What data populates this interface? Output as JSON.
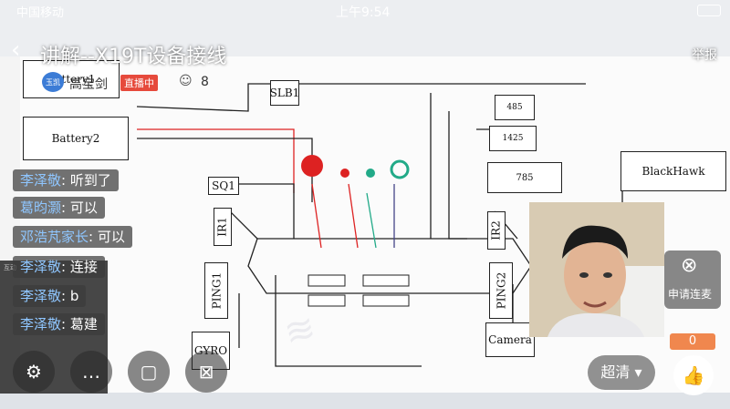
{
  "status_bar": {
    "carrier": "中国移动",
    "time": "上午9:54"
  },
  "stream": {
    "title": "讲解--X19T设备接线",
    "host_name": "高宝剑",
    "host_avatar_text": "玉凯",
    "live_badge": "直播中",
    "viewer_count": "8",
    "report": "举报",
    "comments": [
      {
        "user": "李泽敬",
        "text": "听到了"
      },
      {
        "user": "葛昀灏",
        "text": "可以"
      },
      {
        "user": "邓浩芃家长",
        "text": "可以"
      },
      {
        "user": "李泽敬",
        "text": "连接"
      },
      {
        "user": "李泽敬",
        "text": "b"
      },
      {
        "user": "李泽敬",
        "text": "葛建"
      }
    ],
    "mini_panel_title": "互动",
    "lianmai_label": "申请连麦",
    "gift_count": "0",
    "quality": "超清",
    "bottom_icons": [
      "settings-icon",
      "comment-icon",
      "gift-icon",
      "screen-share-icon"
    ]
  },
  "diagram": {
    "battery1": "Battery1",
    "battery2": "Battery2",
    "slb1": "SLB1",
    "sq1": "SQ1",
    "ir1": "IR1",
    "ping1": "PING1",
    "gyro": "GYRO",
    "ping2": "PING2",
    "ir2": "IR2",
    "camera": "Camera",
    "blackhawk": "BlackHawk",
    "servo1": "485",
    "servo2": "1425",
    "servo3": "785"
  },
  "colors": {
    "live_red": "#e64a3c",
    "comment_user": "#8fc6ff",
    "gift_orange": "#f0874e"
  }
}
